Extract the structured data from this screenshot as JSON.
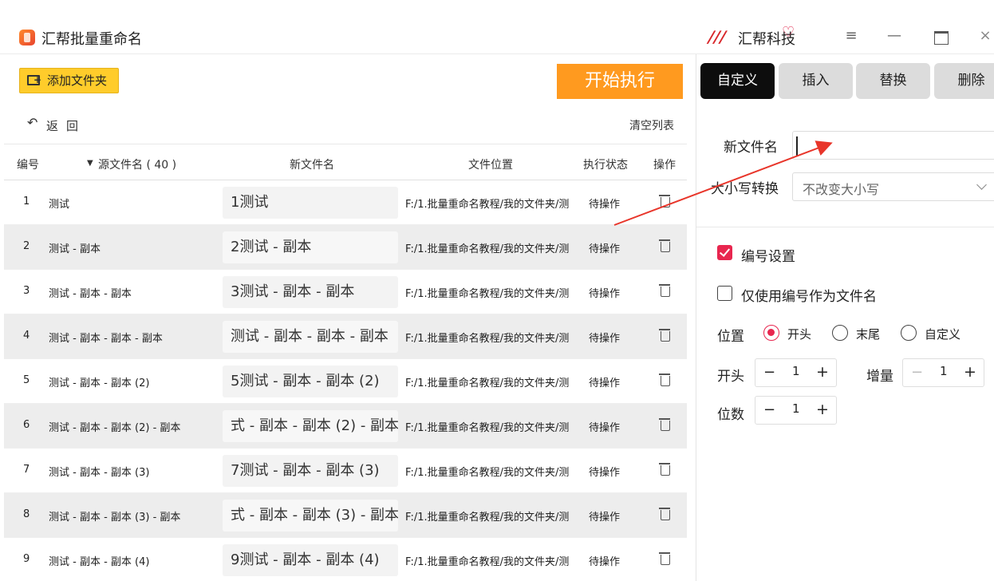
{
  "app": {
    "title": "汇帮批量重命名",
    "brand_name": "汇帮科技",
    "brand_logo_glyph": "///",
    "brand_badge_glyph": "♡",
    "menu_glyph": "≡",
    "minimize_glyph": "—",
    "close_glyph": "×"
  },
  "toolbar": {
    "add_folder_label": "添加文件夹",
    "start_label": "开始执行",
    "back_glyph": "↶",
    "back_label": "返回",
    "clear_list_label": "清空列表"
  },
  "table": {
    "headers": {
      "no": "编号",
      "src_arrow": "▼",
      "src": "源文件名 ( 40 )",
      "new": "新文件名",
      "path": "文件位置",
      "status": "执行状态",
      "op": "操作"
    },
    "rows": [
      {
        "no": "1",
        "src": "测试",
        "new": "1测试",
        "path": "F:/1.批量重命名教程/我的文件夹/测",
        "status": "待操作"
      },
      {
        "no": "2",
        "src": "测试 - 副本",
        "new": "2测试 - 副本",
        "path": "F:/1.批量重命名教程/我的文件夹/测",
        "status": "待操作"
      },
      {
        "no": "3",
        "src": "测试 - 副本 - 副本",
        "new": "3测试 - 副本 - 副本",
        "path": "F:/1.批量重命名教程/我的文件夹/测",
        "status": "待操作"
      },
      {
        "no": "4",
        "src": "测试 - 副本 - 副本 - 副本",
        "new": "测试 - 副本 - 副本 - 副本",
        "path": "F:/1.批量重命名教程/我的文件夹/测",
        "status": "待操作"
      },
      {
        "no": "5",
        "src": "测试 - 副本 - 副本 (2)",
        "new": "5测试 - 副本 - 副本 (2)",
        "path": "F:/1.批量重命名教程/我的文件夹/测",
        "status": "待操作"
      },
      {
        "no": "6",
        "src": "测试 - 副本 - 副本 (2) - 副本",
        "new": "式 - 副本 - 副本 (2) - 副本",
        "path": "F:/1.批量重命名教程/我的文件夹/测",
        "status": "待操作"
      },
      {
        "no": "7",
        "src": "测试 - 副本 - 副本 (3)",
        "new": "7测试 - 副本 - 副本 (3)",
        "path": "F:/1.批量重命名教程/我的文件夹/测",
        "status": "待操作"
      },
      {
        "no": "8",
        "src": "测试 - 副本 - 副本 (3) - 副本",
        "new": "式 - 副本 - 副本 (3) - 副本",
        "path": "F:/1.批量重命名教程/我的文件夹/测",
        "status": "待操作"
      },
      {
        "no": "9",
        "src": "测试 - 副本 - 副本 (4)",
        "new": "9测试 - 副本 - 副本 (4)",
        "path": "F:/1.批量重命名教程/我的文件夹/测",
        "status": "待操作"
      }
    ]
  },
  "tabs": [
    {
      "label": "自定义",
      "active": true
    },
    {
      "label": "插入",
      "active": false
    },
    {
      "label": "替换",
      "active": false
    },
    {
      "label": "删除",
      "active": false
    }
  ],
  "panel": {
    "new_name_label": "新文件名",
    "new_name_value": "",
    "case_label": "大小写转换",
    "case_value": "不改变大小写",
    "numbering_label": "编号设置",
    "numbering_checked": true,
    "only_number_label": "仅使用编号作为文件名",
    "only_number_checked": false,
    "position_label": "位置",
    "position_options": [
      "开头",
      "末尾",
      "自定义"
    ],
    "position_selected": "开头",
    "start_label": "开头",
    "start_value": "1",
    "step_label": "增量",
    "step_value": "1",
    "digits_label": "位数",
    "digits_value": "1",
    "minus_glyph": "−",
    "plus_glyph": "+"
  },
  "colors": {
    "accent_yellow": "#ffcc2b",
    "start_orange": "#ff9a1f",
    "check_red": "#e8264f",
    "tab_active": "#0d0d0d",
    "annotation_red": "#e8352a"
  }
}
